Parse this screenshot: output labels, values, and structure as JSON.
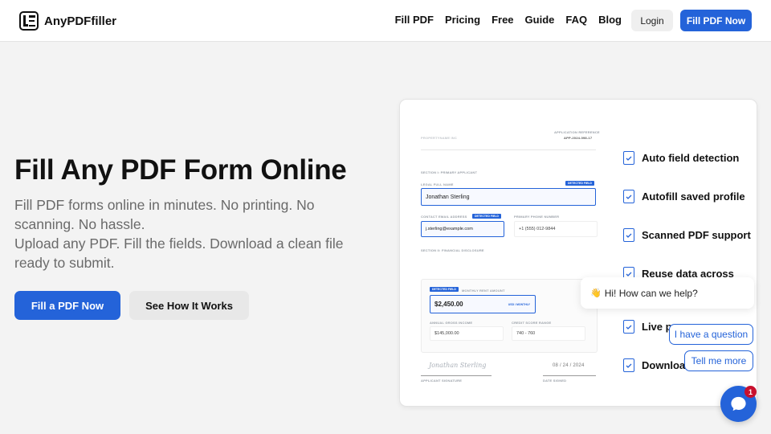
{
  "brand": {
    "name": "AnyPDFfiller"
  },
  "nav": {
    "items": [
      "Fill PDF",
      "Pricing",
      "Free",
      "Guide",
      "FAQ",
      "Blog"
    ],
    "login": "Login",
    "cta": "Fill PDF Now"
  },
  "hero": {
    "title": "Fill Any PDF Form Online",
    "subtitle_lines": [
      "Fill PDF forms online in minutes. No printing. No",
      "scanning. No hassle.",
      "Upload any PDF. Fill the fields. Download a clean file",
      "ready to submit."
    ],
    "primary_button": "Fill a PDF Now",
    "secondary_button": "See How It Works"
  },
  "doc_preview": {
    "header_left": "PROPERTYNAME INC",
    "ref_label": "APPLICATION REFERENCE",
    "ref_value": "APP-2024-098-17",
    "section1": "SECTION I: PRIMARY APPLICANT",
    "legal_name_label": "LEGAL FULL NAME",
    "legal_name_value": "Jonathan Sterling",
    "detected_badge": "DETECTED FIELD",
    "email_label": "CONTACT EMAIL ADDRESS",
    "email_value": "j.sterling@example.com",
    "phone_label": "PRIMARY PHONE NUMBER",
    "phone_value": "+1 (555) 012-9844",
    "section2": "SECTION II: FINANCIAL DISCLOSURE",
    "rent_label": "MONTHLY RENT AMOUNT",
    "rent_value": "$2,450.00",
    "rent_unit": "USD / MONTHLY",
    "income_label": "ANNUAL GROSS INCOME",
    "income_value": "$145,000.00",
    "credit_label": "CREDIT SCORE RANGE",
    "credit_value": "740 - 760",
    "signature": "Jonathan Sterling",
    "signature_label": "APPLICANT SIGNATURE",
    "date_value": "08 / 24 / 2024",
    "date_label": "DATE SIGNED"
  },
  "features": [
    {
      "label": "Auto field detection",
      "icon": "document-check-icon"
    },
    {
      "label": "Autofill saved profile",
      "icon": "document-check-icon"
    },
    {
      "label": "Scanned PDF support",
      "icon": "document-check-icon"
    },
    {
      "label": "Reuse data across",
      "icon": "document-check-icon"
    },
    {
      "label": "Live p",
      "icon": "document-check-icon"
    },
    {
      "label": "Download",
      "icon": "document-check-icon"
    }
  ],
  "chat": {
    "greeting": "Hi! How can we help?",
    "wave_icon": "👋",
    "option1": "I have a question",
    "option2": "Tell me more",
    "unread_count": "1"
  },
  "colors": {
    "accent": "#2463d9",
    "badge": "#c8102e",
    "background": "#f3f3f3"
  }
}
